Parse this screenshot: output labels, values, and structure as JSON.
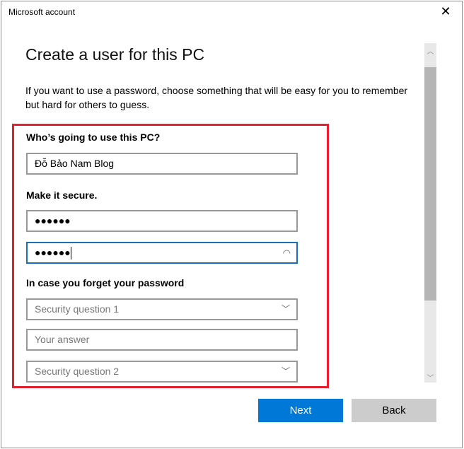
{
  "window": {
    "title": "Microsoft account",
    "close_icon": "close-icon"
  },
  "heading": "Create a user for this PC",
  "intro_line1": "If you want to use a password, choose something that will be easy for you to remember",
  "intro_line2": "but hard for others to guess.",
  "highlight_color": "#e3202b",
  "form": {
    "who_label": "Who’s going to use this PC?",
    "username_value": "Đỗ Bảo Nam Blog",
    "secure_label": "Make it secure.",
    "password_value": "●●●●●●",
    "confirm_value": "●●●●●●",
    "forgot_label": "In case you forget your password",
    "question1_placeholder": "Security question 1",
    "answer1_placeholder": "Your answer",
    "question2_placeholder": "Security question 2"
  },
  "buttons": {
    "next": "Next",
    "back": "Back"
  },
  "accent": "#0078d7"
}
